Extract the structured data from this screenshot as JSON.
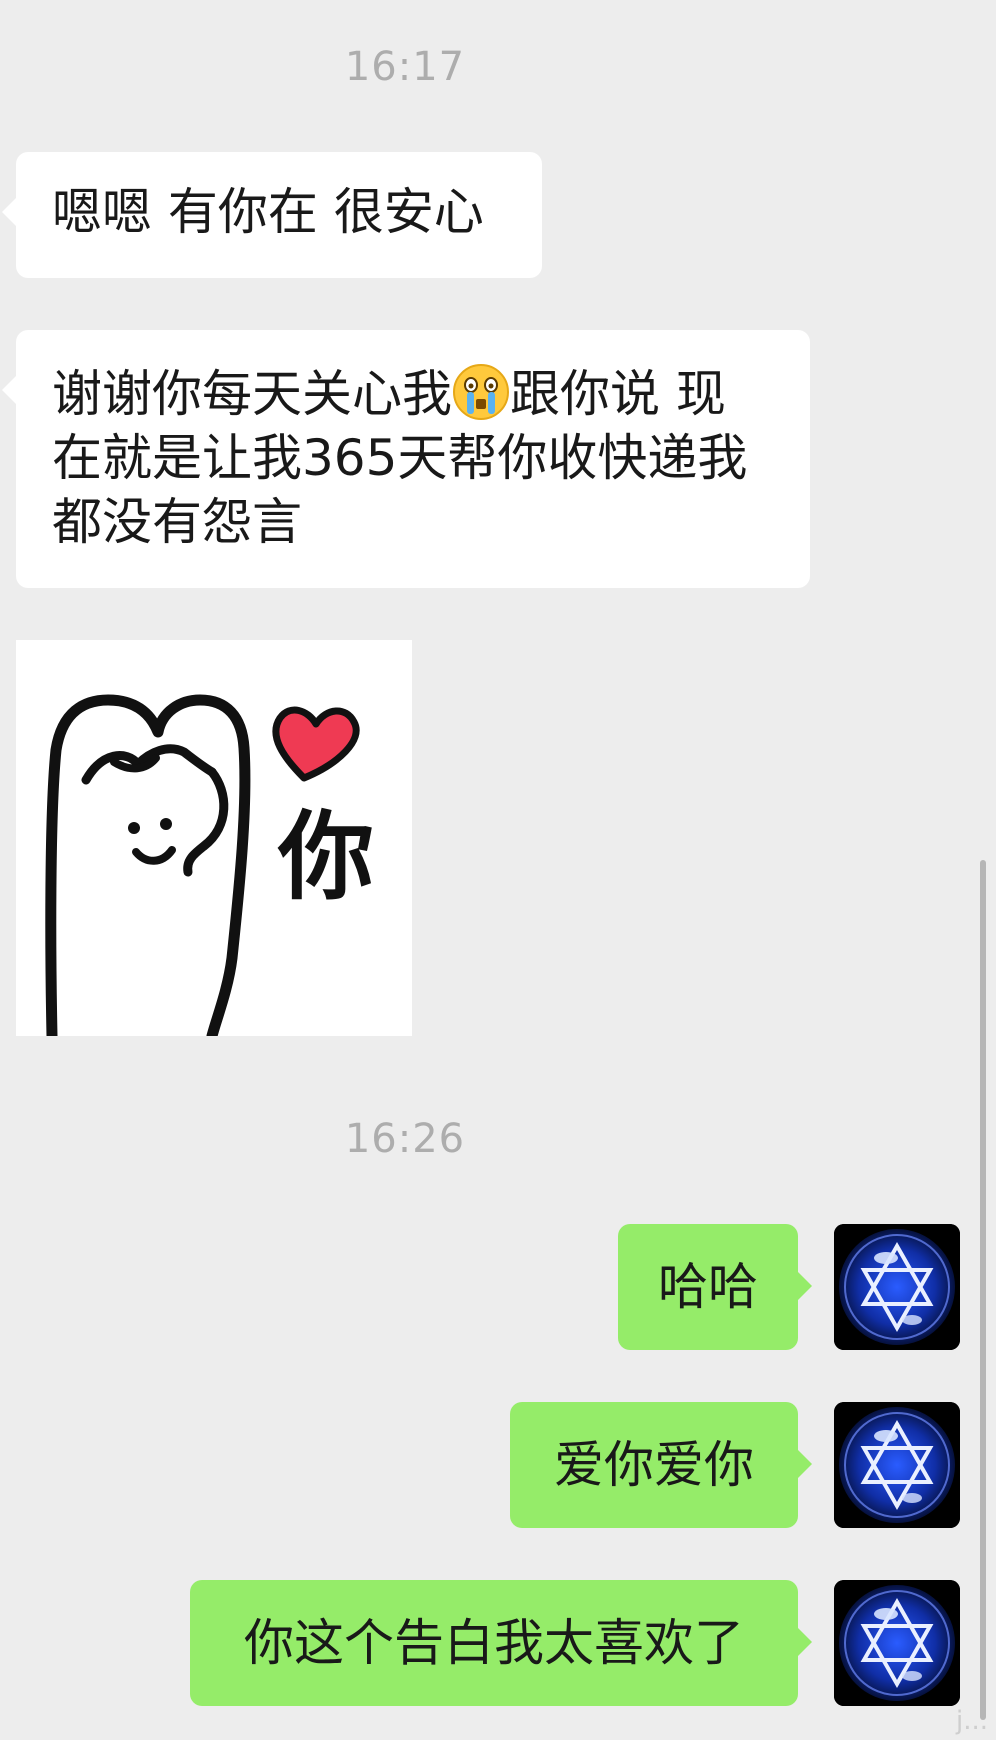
{
  "chat": {
    "timestamps": [
      "16:17",
      "16:26"
    ],
    "received": {
      "msg1": "嗯嗯 有你在 很安心",
      "msg2_before_emoji": "谢谢你每天关心我",
      "msg2_after_emoji": "跟你说 现在就是让我365天帮你收快递我都没有怨言",
      "sticker_text": "你",
      "emoji_name": "crying-face-icon"
    },
    "sent": [
      "哈哈",
      "爱你爱你",
      "你这个告白我太喜欢了"
    ],
    "avatar_icon": "star-of-david-avatar-icon"
  },
  "watermark": "j..."
}
